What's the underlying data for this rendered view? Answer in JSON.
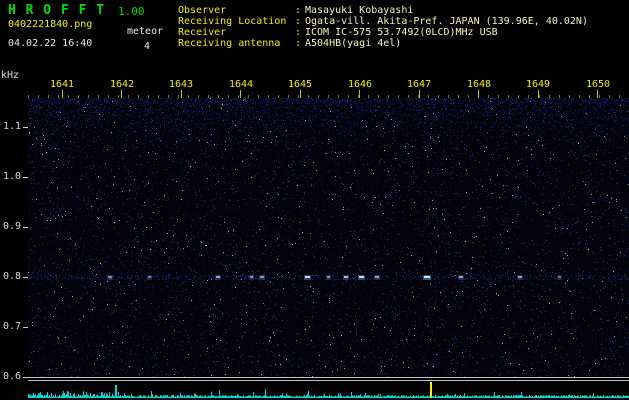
{
  "app": {
    "title": "H R O F F T",
    "version": "1.00",
    "filename": "0402221840.png",
    "mode_label": "meteor",
    "echo_count": "4",
    "datetime": "04.02.22 16:40"
  },
  "info": {
    "separator": ":",
    "rows": [
      {
        "label": "Observer",
        "value": "Masayuki Kobayashi"
      },
      {
        "label": "Receiving Location",
        "value": "Ogata-vill. Akita-Pref. JAPAN (139.96E, 40.02N)"
      },
      {
        "label": "Receiver",
        "value": "ICOM IC-575 53.7492(0LCD)MHz USB"
      },
      {
        "label": "Receiving antenna",
        "value": "A504HB(yagi 4el)"
      }
    ]
  },
  "colors": {
    "background": "#000000",
    "title_green": "#00dc00",
    "header_yellow": "#f0f000",
    "header_white": "#e8e8e8",
    "axis_label": "#d8d8d8",
    "tick_yellow": "#c8c800",
    "tick_minor_yellow": "#7a7a00",
    "spec_bg": "#020208",
    "amp_cyan": "#00d8d8",
    "amp_spike_yellow": "#f0f000",
    "separator_line": "#c0c0c0"
  },
  "chart_data": {
    "type": "heatmap",
    "title": "",
    "ylabel": "kHz",
    "x_ticks": [
      "1641",
      "1642",
      "1643",
      "1644",
      "1645",
      "1646",
      "1647",
      "1648",
      "1649",
      "1650"
    ],
    "y_ticks": [
      "1.1",
      "1.0",
      "0.9",
      "0.8",
      "0.7",
      "0.6"
    ],
    "x_range_minutes": [
      0,
      10
    ],
    "y_range_khz": [
      0.6,
      1.158
    ],
    "grid": "off",
    "legend": "off",
    "echo_band_khz": 0.8,
    "echoes": [
      {
        "t": 1.37,
        "w": 4,
        "b": 0.5
      },
      {
        "t": 2.03,
        "w": 3,
        "b": 0.45
      },
      {
        "t": 3.17,
        "w": 4,
        "b": 0.6
      },
      {
        "t": 3.73,
        "w": 3,
        "b": 0.5
      },
      {
        "t": 3.9,
        "w": 4,
        "b": 0.55
      },
      {
        "t": 4.66,
        "w": 5,
        "b": 0.85
      },
      {
        "t": 5.0,
        "w": 3,
        "b": 0.5
      },
      {
        "t": 5.3,
        "w": 4,
        "b": 0.7
      },
      {
        "t": 5.56,
        "w": 5,
        "b": 0.85
      },
      {
        "t": 5.82,
        "w": 4,
        "b": 0.6
      },
      {
        "t": 6.65,
        "w": 6,
        "b": 0.95
      },
      {
        "t": 7.22,
        "w": 4,
        "b": 0.6
      },
      {
        "t": 8.19,
        "w": 4,
        "b": 0.55
      },
      {
        "t": 8.85,
        "w": 3,
        "b": 0.4
      }
    ],
    "amplitude_spikes": [
      {
        "t": 0.08,
        "h": 5
      },
      {
        "t": 0.2,
        "h": 4
      },
      {
        "t": 0.32,
        "h": 6
      },
      {
        "t": 0.45,
        "h": 4
      },
      {
        "t": 0.58,
        "h": 7
      },
      {
        "t": 0.7,
        "h": 5
      },
      {
        "t": 0.83,
        "h": 4
      },
      {
        "t": 0.96,
        "h": 6
      },
      {
        "t": 1.1,
        "h": 4
      },
      {
        "t": 1.27,
        "h": 5
      },
      {
        "t": 1.45,
        "h": 13
      },
      {
        "t": 1.72,
        "h": 4
      },
      {
        "t": 2.05,
        "h": 7
      },
      {
        "t": 2.42,
        "h": 3
      },
      {
        "t": 2.78,
        "h": 4
      },
      {
        "t": 3.17,
        "h": 8
      },
      {
        "t": 3.47,
        "h": 4
      },
      {
        "t": 3.75,
        "h": 6
      },
      {
        "t": 3.95,
        "h": 9
      },
      {
        "t": 4.3,
        "h": 4
      },
      {
        "t": 4.66,
        "h": 7
      },
      {
        "t": 4.92,
        "h": 4
      },
      {
        "t": 5.15,
        "h": 5
      },
      {
        "t": 5.37,
        "h": 6
      },
      {
        "t": 5.6,
        "h": 5
      },
      {
        "t": 5.85,
        "h": 4
      },
      {
        "t": 6.2,
        "h": 3
      },
      {
        "t": 6.69,
        "h": 16,
        "c": "#f0f000"
      },
      {
        "t": 6.98,
        "h": 4
      },
      {
        "t": 7.25,
        "h": 5
      },
      {
        "t": 7.6,
        "h": 3
      },
      {
        "t": 8.2,
        "h": 6
      },
      {
        "t": 8.62,
        "h": 3
      },
      {
        "t": 9.0,
        "h": 4
      },
      {
        "t": 9.4,
        "h": 5
      },
      {
        "t": 9.72,
        "h": 3
      }
    ]
  }
}
